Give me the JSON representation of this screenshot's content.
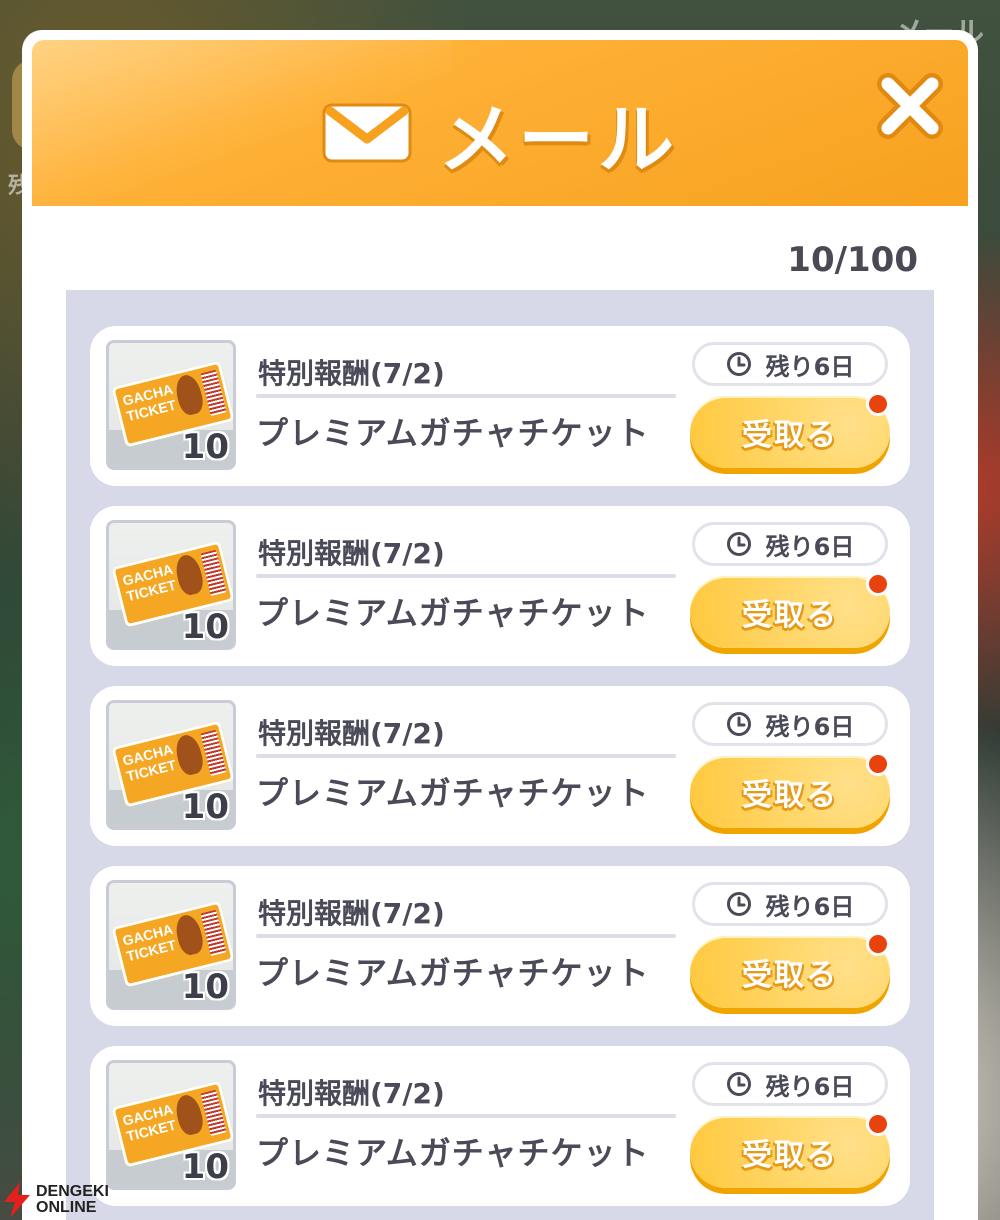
{
  "background": {
    "top_text": "メール",
    "side_char": "残"
  },
  "header": {
    "title": "メール",
    "close_symbol": "✕"
  },
  "counter": "10/100",
  "mails": [
    {
      "title": "特別報酬(7/2)",
      "item_name": "プレミアムガチャチケット",
      "quantity": "10",
      "time_left": "残り6日",
      "claim_label": "受取る",
      "ticket_text": "GACHA TICKET"
    },
    {
      "title": "特別報酬(7/2)",
      "item_name": "プレミアムガチャチケット",
      "quantity": "10",
      "time_left": "残り6日",
      "claim_label": "受取る",
      "ticket_text": "GACHA TICKET"
    },
    {
      "title": "特別報酬(7/2)",
      "item_name": "プレミアムガチャチケット",
      "quantity": "10",
      "time_left": "残り6日",
      "claim_label": "受取る",
      "ticket_text": "GACHA TICKET"
    },
    {
      "title": "特別報酬(7/2)",
      "item_name": "プレミアムガチャチケット",
      "quantity": "10",
      "time_left": "残り6日",
      "claim_label": "受取る",
      "ticket_text": "GACHA TICKET"
    },
    {
      "title": "特別報酬(7/2)",
      "item_name": "プレミアムガチャチケット",
      "quantity": "10",
      "time_left": "残り6日",
      "claim_label": "受取る",
      "ticket_text": "GACHA TICKET"
    }
  ],
  "watermark": {
    "line1": "DENGEKI",
    "line2": "ONLINE"
  },
  "colors": {
    "header_orange": "#f7a11f",
    "list_bg": "#d7d9e8",
    "claim_yellow": "#ffd669",
    "badge_red": "#e8430f"
  }
}
